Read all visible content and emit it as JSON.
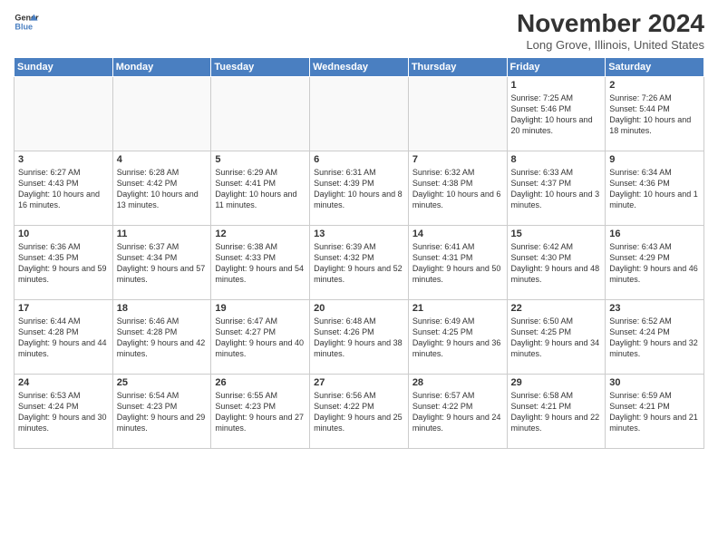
{
  "header": {
    "logo_line1": "General",
    "logo_line2": "Blue",
    "month": "November 2024",
    "location": "Long Grove, Illinois, United States"
  },
  "days_of_week": [
    "Sunday",
    "Monday",
    "Tuesday",
    "Wednesday",
    "Thursday",
    "Friday",
    "Saturday"
  ],
  "weeks": [
    [
      {
        "day": "",
        "info": ""
      },
      {
        "day": "",
        "info": ""
      },
      {
        "day": "",
        "info": ""
      },
      {
        "day": "",
        "info": ""
      },
      {
        "day": "",
        "info": ""
      },
      {
        "day": "1",
        "info": "Sunrise: 7:25 AM\nSunset: 5:46 PM\nDaylight: 10 hours and 20 minutes."
      },
      {
        "day": "2",
        "info": "Sunrise: 7:26 AM\nSunset: 5:44 PM\nDaylight: 10 hours and 18 minutes."
      }
    ],
    [
      {
        "day": "3",
        "info": "Sunrise: 6:27 AM\nSunset: 4:43 PM\nDaylight: 10 hours and 16 minutes."
      },
      {
        "day": "4",
        "info": "Sunrise: 6:28 AM\nSunset: 4:42 PM\nDaylight: 10 hours and 13 minutes."
      },
      {
        "day": "5",
        "info": "Sunrise: 6:29 AM\nSunset: 4:41 PM\nDaylight: 10 hours and 11 minutes."
      },
      {
        "day": "6",
        "info": "Sunrise: 6:31 AM\nSunset: 4:39 PM\nDaylight: 10 hours and 8 minutes."
      },
      {
        "day": "7",
        "info": "Sunrise: 6:32 AM\nSunset: 4:38 PM\nDaylight: 10 hours and 6 minutes."
      },
      {
        "day": "8",
        "info": "Sunrise: 6:33 AM\nSunset: 4:37 PM\nDaylight: 10 hours and 3 minutes."
      },
      {
        "day": "9",
        "info": "Sunrise: 6:34 AM\nSunset: 4:36 PM\nDaylight: 10 hours and 1 minute."
      }
    ],
    [
      {
        "day": "10",
        "info": "Sunrise: 6:36 AM\nSunset: 4:35 PM\nDaylight: 9 hours and 59 minutes."
      },
      {
        "day": "11",
        "info": "Sunrise: 6:37 AM\nSunset: 4:34 PM\nDaylight: 9 hours and 57 minutes."
      },
      {
        "day": "12",
        "info": "Sunrise: 6:38 AM\nSunset: 4:33 PM\nDaylight: 9 hours and 54 minutes."
      },
      {
        "day": "13",
        "info": "Sunrise: 6:39 AM\nSunset: 4:32 PM\nDaylight: 9 hours and 52 minutes."
      },
      {
        "day": "14",
        "info": "Sunrise: 6:41 AM\nSunset: 4:31 PM\nDaylight: 9 hours and 50 minutes."
      },
      {
        "day": "15",
        "info": "Sunrise: 6:42 AM\nSunset: 4:30 PM\nDaylight: 9 hours and 48 minutes."
      },
      {
        "day": "16",
        "info": "Sunrise: 6:43 AM\nSunset: 4:29 PM\nDaylight: 9 hours and 46 minutes."
      }
    ],
    [
      {
        "day": "17",
        "info": "Sunrise: 6:44 AM\nSunset: 4:28 PM\nDaylight: 9 hours and 44 minutes."
      },
      {
        "day": "18",
        "info": "Sunrise: 6:46 AM\nSunset: 4:28 PM\nDaylight: 9 hours and 42 minutes."
      },
      {
        "day": "19",
        "info": "Sunrise: 6:47 AM\nSunset: 4:27 PM\nDaylight: 9 hours and 40 minutes."
      },
      {
        "day": "20",
        "info": "Sunrise: 6:48 AM\nSunset: 4:26 PM\nDaylight: 9 hours and 38 minutes."
      },
      {
        "day": "21",
        "info": "Sunrise: 6:49 AM\nSunset: 4:25 PM\nDaylight: 9 hours and 36 minutes."
      },
      {
        "day": "22",
        "info": "Sunrise: 6:50 AM\nSunset: 4:25 PM\nDaylight: 9 hours and 34 minutes."
      },
      {
        "day": "23",
        "info": "Sunrise: 6:52 AM\nSunset: 4:24 PM\nDaylight: 9 hours and 32 minutes."
      }
    ],
    [
      {
        "day": "24",
        "info": "Sunrise: 6:53 AM\nSunset: 4:24 PM\nDaylight: 9 hours and 30 minutes."
      },
      {
        "day": "25",
        "info": "Sunrise: 6:54 AM\nSunset: 4:23 PM\nDaylight: 9 hours and 29 minutes."
      },
      {
        "day": "26",
        "info": "Sunrise: 6:55 AM\nSunset: 4:23 PM\nDaylight: 9 hours and 27 minutes."
      },
      {
        "day": "27",
        "info": "Sunrise: 6:56 AM\nSunset: 4:22 PM\nDaylight: 9 hours and 25 minutes."
      },
      {
        "day": "28",
        "info": "Sunrise: 6:57 AM\nSunset: 4:22 PM\nDaylight: 9 hours and 24 minutes."
      },
      {
        "day": "29",
        "info": "Sunrise: 6:58 AM\nSunset: 4:21 PM\nDaylight: 9 hours and 22 minutes."
      },
      {
        "day": "30",
        "info": "Sunrise: 6:59 AM\nSunset: 4:21 PM\nDaylight: 9 hours and 21 minutes."
      }
    ]
  ]
}
